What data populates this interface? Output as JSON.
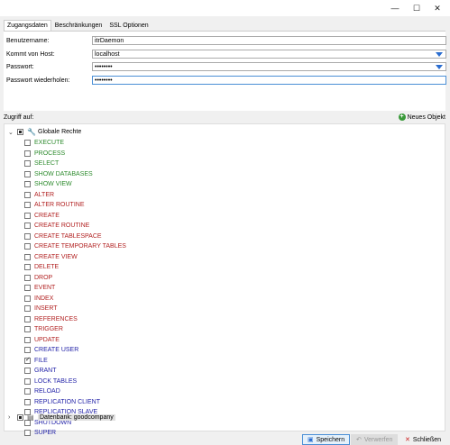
{
  "window": {
    "minimize_icon": "minimize-icon",
    "maximize_icon": "maximize-icon",
    "close_icon": "close-icon"
  },
  "tabs": [
    "Zugangsdaten",
    "Beschränkungen",
    "SSL Optionen"
  ],
  "form": {
    "user_label": "Benutzername:",
    "user_value": "itrDaemon",
    "host_label": "Kommt von Host:",
    "host_value": "localhost",
    "pw_label": "Passwort:",
    "pw_value": "••••••••",
    "pw2_label": "Passwort wiederholen:",
    "pw2_value": "••••••••"
  },
  "access_label": "Zugriff auf:",
  "new_object": "Neues Objekt",
  "tree": {
    "root": "Globale Rechte",
    "privileges": [
      {
        "label": "EXECUTE",
        "color": "green",
        "checked": false
      },
      {
        "label": "PROCESS",
        "color": "green",
        "checked": false
      },
      {
        "label": "SELECT",
        "color": "green",
        "checked": false
      },
      {
        "label": "SHOW DATABASES",
        "color": "green",
        "checked": false
      },
      {
        "label": "SHOW VIEW",
        "color": "green",
        "checked": false
      },
      {
        "label": "ALTER",
        "color": "red",
        "checked": false
      },
      {
        "label": "ALTER ROUTINE",
        "color": "red",
        "checked": false
      },
      {
        "label": "CREATE",
        "color": "red",
        "checked": false
      },
      {
        "label": "CREATE ROUTINE",
        "color": "red",
        "checked": false
      },
      {
        "label": "CREATE TABLESPACE",
        "color": "red",
        "checked": false
      },
      {
        "label": "CREATE TEMPORARY TABLES",
        "color": "red",
        "checked": false
      },
      {
        "label": "CREATE VIEW",
        "color": "red",
        "checked": false
      },
      {
        "label": "DELETE",
        "color": "red",
        "checked": false
      },
      {
        "label": "DROP",
        "color": "red",
        "checked": false
      },
      {
        "label": "EVENT",
        "color": "red",
        "checked": false
      },
      {
        "label": "INDEX",
        "color": "red",
        "checked": false
      },
      {
        "label": "INSERT",
        "color": "red",
        "checked": false
      },
      {
        "label": "REFERENCES",
        "color": "red",
        "checked": false
      },
      {
        "label": "TRIGGER",
        "color": "red",
        "checked": false
      },
      {
        "label": "UPDATE",
        "color": "red",
        "checked": false
      },
      {
        "label": "CREATE USER",
        "color": "blue",
        "checked": false
      },
      {
        "label": "FILE",
        "color": "blue",
        "checked": true
      },
      {
        "label": "GRANT",
        "color": "blue",
        "checked": false
      },
      {
        "label": "LOCK TABLES",
        "color": "blue",
        "checked": false
      },
      {
        "label": "RELOAD",
        "color": "blue",
        "checked": false
      },
      {
        "label": "REPLICATION CLIENT",
        "color": "blue",
        "checked": false
      },
      {
        "label": "REPLICATION SLAVE",
        "color": "blue",
        "checked": false
      },
      {
        "label": "SHUTDOWN",
        "color": "blue",
        "checked": false
      },
      {
        "label": "SUPER",
        "color": "blue",
        "checked": false
      }
    ],
    "db_node": "Datenbank: goodcompany"
  },
  "buttons": {
    "save": "Speichern",
    "discard": "Verwerfen",
    "close": "Schließen"
  }
}
